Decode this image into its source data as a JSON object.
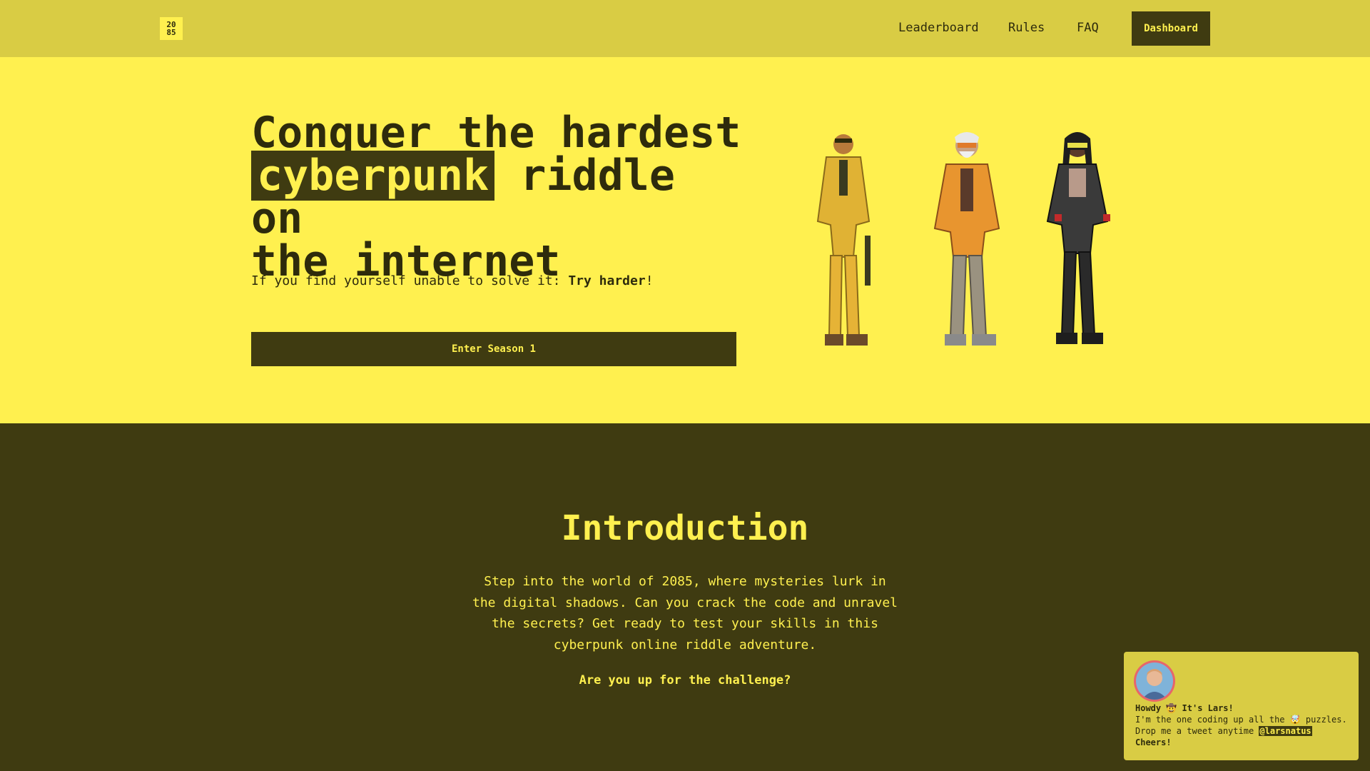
{
  "header": {
    "logo_top": "20",
    "logo_bottom": "85",
    "nav": [
      "Leaderboard",
      "Rules",
      "FAQ"
    ],
    "dashboard_label": "Dashboard"
  },
  "hero": {
    "title_line1": "Conquer the hardest",
    "title_highlight": "cyberpunk",
    "title_line2_rest": " riddle on",
    "title_line3": "the internet",
    "subtitle_prefix": "If you find yourself unable to solve it: ",
    "subtitle_bold": "Try harder",
    "subtitle_suffix": "!",
    "cta_label": "Enter Season 1"
  },
  "intro": {
    "title": "Introduction",
    "body": "Step into the world of 2085, where mysteries lurk in the digital shadows. Can you crack the code and unravel the secrets? Get ready to test your skills in this cyberpunk online riddle adventure.",
    "cta": "Are you up for the challenge?"
  },
  "chat": {
    "greeting": "Howdy 🤠 It's Lars!",
    "line2": "I'm the one coding up all the 🤯 puzzles.",
    "line3_prefix": "Drop me a tweet anytime ",
    "handle": "@larsnatus",
    "signoff": "Cheers!"
  },
  "colors": {
    "header_bg": "#d9cc44",
    "hero_bg": "#fff04f",
    "dark": "#3f3b11",
    "accent": "#fff04f"
  }
}
